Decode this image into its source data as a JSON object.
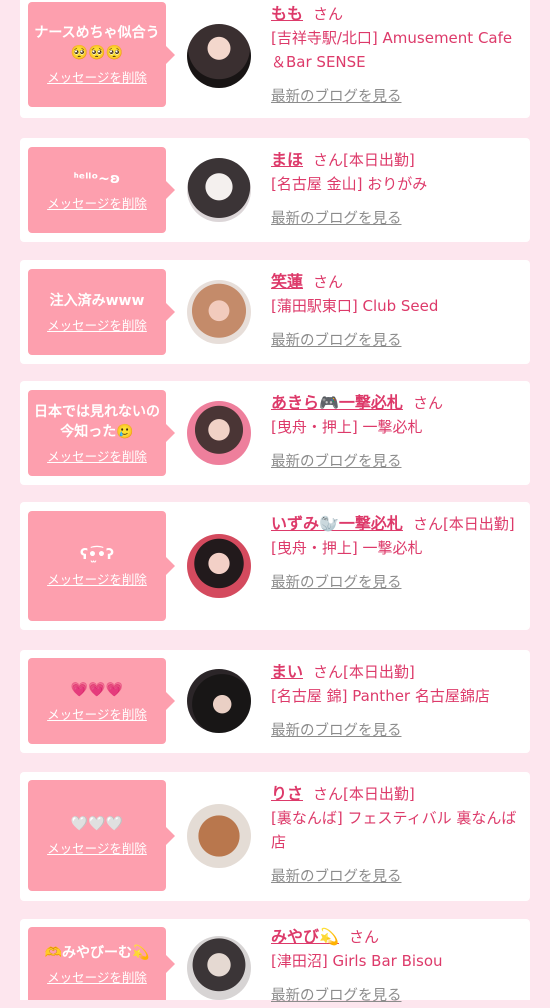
{
  "delete_label": "メッセージを削除",
  "san": "さん",
  "blog_label": "最新のブログを見る",
  "cards": [
    {
      "message": "ナースめちゃ似合う🥺🥺🥺",
      "name": "もも",
      "badge": "",
      "shop": "[吉祥寺駅/北口] Amusement Cafe＆Bar SENSE"
    },
    {
      "message": "ᑋᵉˡˡᵒ~ʚ",
      "name": "まほ",
      "badge": "[本日出勤]",
      "shop": "[名古屋 金山] おりがみ"
    },
    {
      "message": "注入済みwww",
      "name": "笑蓮",
      "badge": "",
      "shop": "[蒲田駅東口] Club Seed"
    },
    {
      "message": "日本では見れないの今知った🥲",
      "name": "あきら🎮一撃必札",
      "badge": "",
      "shop": "[曳舟・押上] 一撃必札"
    },
    {
      "message": "ʕ•̫͡•ʔ",
      "name": "いずみ🦭一撃必札",
      "badge": "[本日出勤]",
      "shop": "[曳舟・押上] 一撃必札"
    },
    {
      "message": "💗💗💗",
      "name": "まい",
      "badge": "[本日出勤]",
      "shop": "[名古屋 錦] Panther 名古屋錦店"
    },
    {
      "message": "🤍🤍🤍",
      "name": "りさ",
      "badge": "[本日出勤]",
      "shop": "[裏なんば] フェスティバル 裏なんば店"
    },
    {
      "message": "🫶みやびーむ💫",
      "name": "みやび💫",
      "badge": "",
      "shop": "[津田沼] Girls Bar Bisou"
    }
  ]
}
